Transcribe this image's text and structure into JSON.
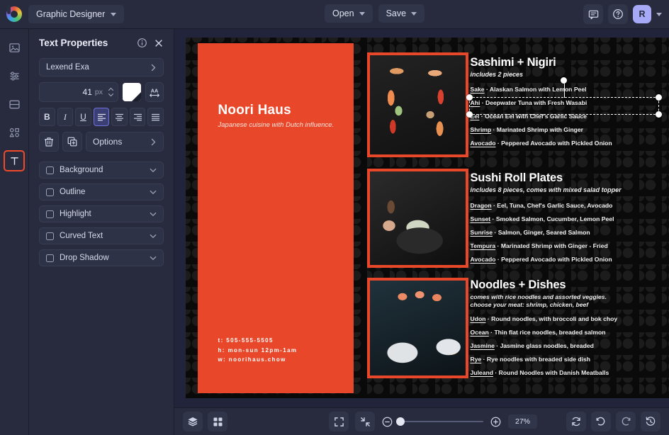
{
  "app": {
    "logo_icon": "rainbow-swirl-logo",
    "menu_label": "Graphic Designer"
  },
  "topbar": {
    "open_label": "Open",
    "save_label": "Save",
    "comments_icon": "comment-icon",
    "help_icon": "help-circle-icon",
    "avatar_initial": "R",
    "avatar_color": "#a6a9f5"
  },
  "rail": {
    "items": [
      {
        "name": "image-tool",
        "icon": "image-icon",
        "active": false
      },
      {
        "name": "adjustments-tool",
        "icon": "sliders-icon",
        "active": false
      },
      {
        "name": "layout-tool",
        "icon": "layout-icon",
        "active": false
      },
      {
        "name": "shapes-tool",
        "icon": "shapes-icon",
        "active": false
      },
      {
        "name": "text-tool",
        "icon": "text-t-icon",
        "active": true
      }
    ],
    "active_outline_color": "#ef4a2a"
  },
  "panel": {
    "title": "Text Properties",
    "info_icon": "info-circle-icon",
    "close_icon": "close-x-icon",
    "font_family": "Lexend Exa",
    "font_size_value": "41",
    "font_size_unit": "px",
    "color_swatch": "#ffffff",
    "letter_spacing_icon": "letter-spacing-icon",
    "format_buttons": [
      {
        "name": "bold-button",
        "label": "B",
        "active": false
      },
      {
        "name": "italic-button",
        "label": "I",
        "active": false
      },
      {
        "name": "underline-button",
        "label": "U",
        "active": false
      },
      {
        "name": "align-left-button",
        "label": "align-left-icon",
        "active": true
      },
      {
        "name": "align-center-button",
        "label": "align-center-icon",
        "active": false
      },
      {
        "name": "align-right-button",
        "label": "align-right-icon",
        "active": false
      },
      {
        "name": "align-justify-button",
        "label": "align-justify-icon",
        "active": false
      }
    ],
    "delete_icon": "trash-icon",
    "duplicate_icon": "duplicate-icon",
    "options_label": "Options",
    "accordions": [
      {
        "label": "Background",
        "checked": false
      },
      {
        "label": "Outline",
        "checked": false
      },
      {
        "label": "Highlight",
        "checked": false
      },
      {
        "label": "Curved Text",
        "checked": false
      },
      {
        "label": "Drop Shadow",
        "checked": false
      }
    ]
  },
  "design": {
    "accent_color": "#e8472a",
    "background_color": "#0a0a0a",
    "brand": "Noori Haus",
    "tagline": "Japanese cuisine with Dutch influence.",
    "contact": {
      "phone": "t: 505-555-5505",
      "hours": "h: mon-sun 12pm-1am",
      "web": "w: noorihaus.chow"
    },
    "sections": [
      {
        "title": "Sashimi + Nigiri",
        "subtitle": "includes 2 pieces",
        "photo_name": "sushi-platter-photo",
        "items": [
          {
            "name": "Sake",
            "desc": "Alaskan Salmon with Lemon Peel",
            "selected": true
          },
          {
            "name": "Ahi",
            "desc": "Deepwater Tuna with Fresh Wasabi",
            "selected": false
          },
          {
            "name": "Eel",
            "desc": "Ocean Eel with Chef's Garlic Sauce",
            "selected": false
          },
          {
            "name": "Shrimp",
            "desc": "Marinated Shrimp with Ginger",
            "selected": false
          },
          {
            "name": "Avocado",
            "desc": "Peppered Avocado with Pickled Onion",
            "selected": false
          }
        ]
      },
      {
        "title": "Sushi Roll Plates",
        "subtitle": "includes 8 pieces, comes with mixed salad topper",
        "photo_name": "chef-plate-photo",
        "items": [
          {
            "name": "Dragon",
            "desc": "Eel, Tuna, Chef's Garlic Sauce, Avocado",
            "selected": false
          },
          {
            "name": "Sunset",
            "desc": "Smoked Salmon, Cucumber, Lemon Peel",
            "selected": false
          },
          {
            "name": "Sunrise",
            "desc": "Salmon, Ginger, Seared Salmon",
            "selected": false
          },
          {
            "name": "Tempura",
            "desc": "Marinated Shrimp with Ginger - Fried",
            "selected": false
          },
          {
            "name": "Avocado",
            "desc": "Peppered Avocado with Pickled Onion",
            "selected": false
          }
        ]
      },
      {
        "title": "Noodles + Dishes",
        "subtitle": "comes with rice noodles and assorted veggies.",
        "subtitle2": "choose your meat: shrimp, chicken, beef",
        "photo_name": "noodle-bowls-photo",
        "items": [
          {
            "name": "Udon",
            "desc": "Round noodles, with broccoli and bok choy",
            "selected": false
          },
          {
            "name": "Ocean",
            "desc": "Thin flat rice noodles, breaded salmon",
            "selected": false
          },
          {
            "name": "Jasmine",
            "desc": "Jasmine glass noodles, breaded",
            "selected": false
          },
          {
            "name": "Rye",
            "desc": "Rye noodles with breaded side dish",
            "selected": false
          },
          {
            "name": "Juleand",
            "desc": "Round Noodles with Danish Meatballs",
            "selected": false
          }
        ]
      }
    ],
    "separator": "·"
  },
  "bottombar": {
    "layers_icon": "layers-icon",
    "grid_icon": "grid-icon",
    "fit_icon": "fit-screen-icon",
    "shrink_icon": "shrink-icon",
    "zoom_out_icon": "zoom-out-icon",
    "zoom_in_icon": "zoom-in-icon",
    "zoom_value": "27%",
    "sync_icon": "sync-icon",
    "undo_icon": "undo-icon",
    "redo_icon": "redo-icon",
    "history_icon": "history-icon"
  }
}
